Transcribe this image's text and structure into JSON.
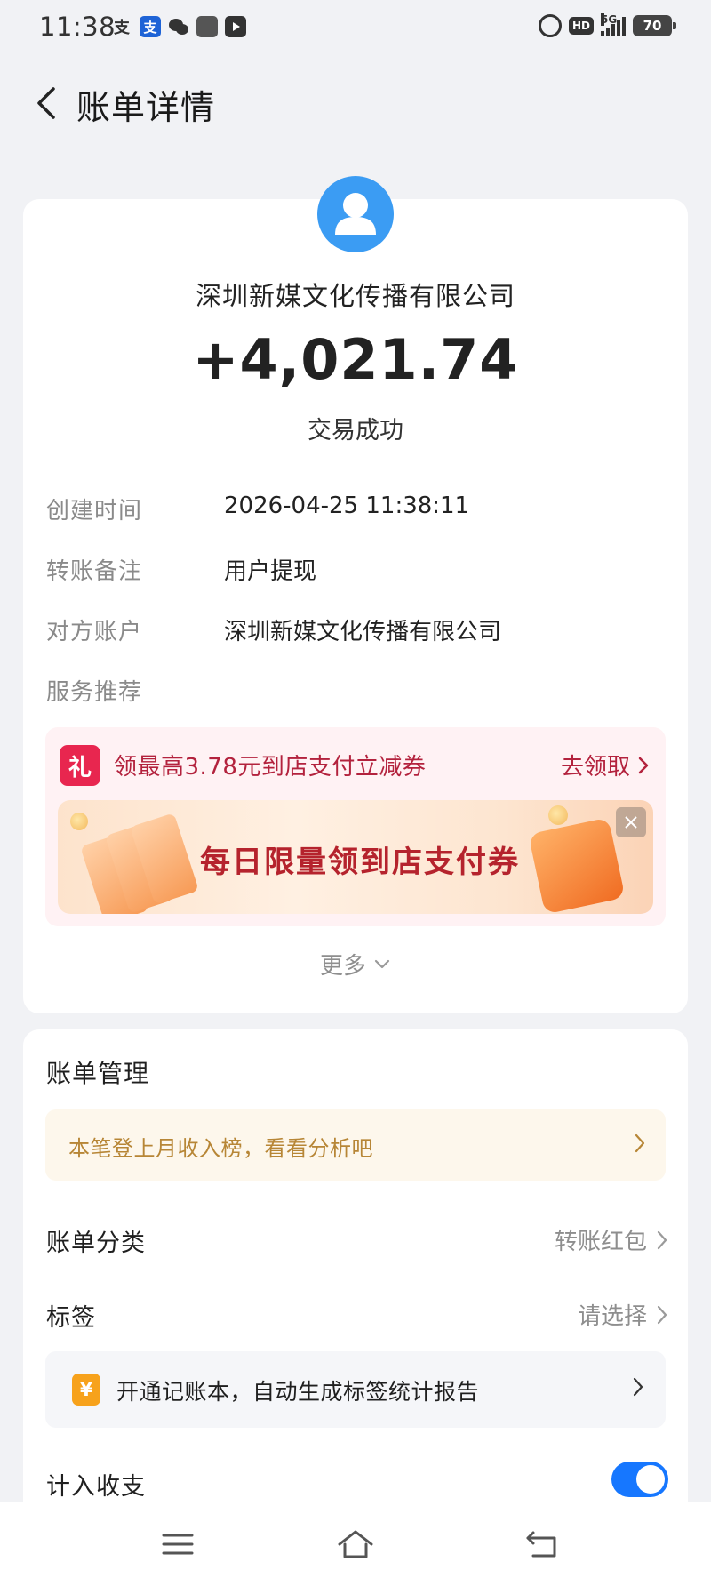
{
  "status_bar": {
    "time": "11:38",
    "network": "5G",
    "hd": "HD",
    "battery": "70"
  },
  "header": {
    "title": "账单详情"
  },
  "transaction": {
    "merchant": "深圳新媒文化传播有限公司",
    "amount": "+4,021.74",
    "status": "交易成功"
  },
  "details": [
    {
      "label": "创建时间",
      "value": "2026-04-25 11:38:11"
    },
    {
      "label": "转账备注",
      "value": "用户提现"
    },
    {
      "label": "对方账户",
      "value": "深圳新媒文化传播有限公司"
    },
    {
      "label": "服务推荐",
      "value": ""
    }
  ],
  "promo": {
    "gift_glyph": "礼",
    "text": "领最高3.78元到店支付立减券",
    "claim": "去领取",
    "banner_text": "每日限量领到店支付券"
  },
  "more_label": "更多",
  "bill_manage": {
    "title": "账单管理",
    "ranking_text": "本笔登上月收入榜，看看分析吧",
    "category_label": "账单分类",
    "category_value": "转账红包",
    "tag_label": "标签",
    "tag_value": "请选择",
    "ledger_icon": "¥",
    "ledger_text": "开通记账本，自动生成标签统计报告",
    "include_label": "计入收支",
    "include_on": true
  },
  "colors": {
    "accent_blue": "#1677ff",
    "avatar_blue": "#3b9cf3",
    "promo_red": "#b3223d",
    "ranking_gold": "#b78636"
  },
  "icons": [
    "back-icon",
    "user-icon",
    "gift-icon",
    "chevron-right-icon",
    "close-icon",
    "chevron-down-icon",
    "yen-icon",
    "menu-icon",
    "home-icon",
    "return-icon"
  ]
}
